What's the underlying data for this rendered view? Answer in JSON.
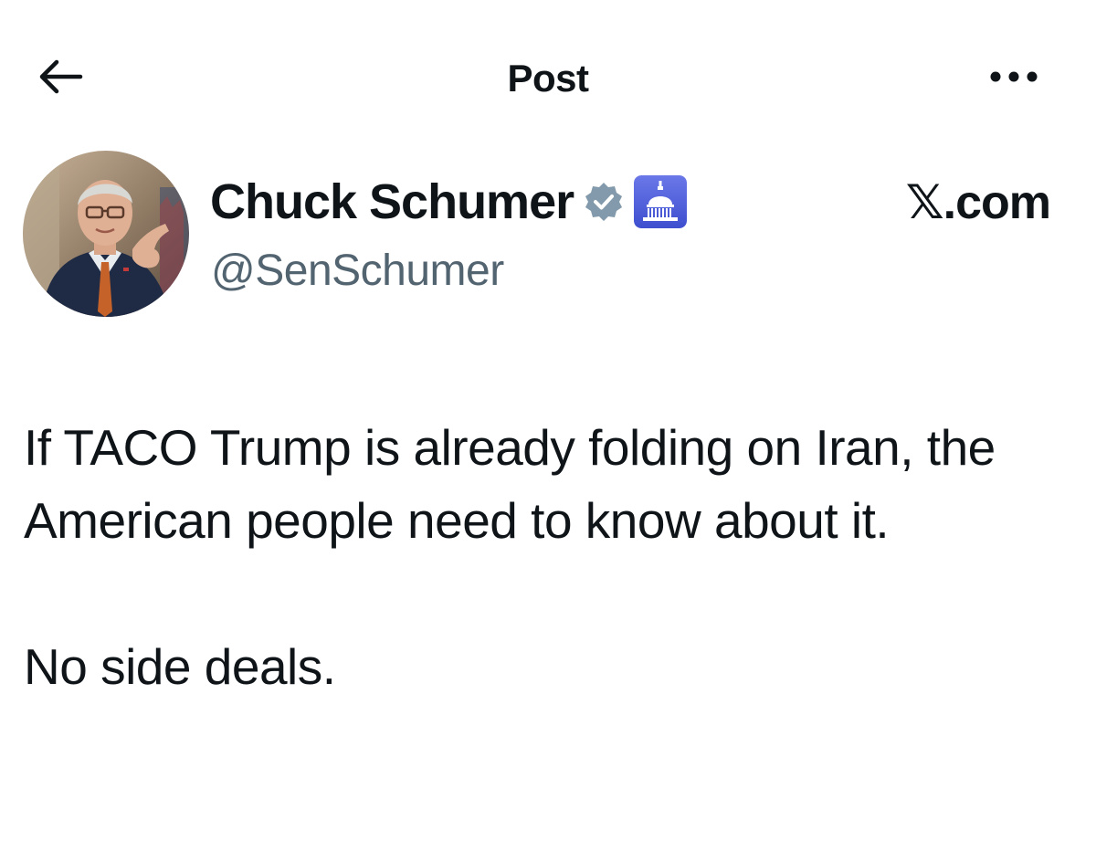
{
  "header": {
    "title": "Post",
    "back_icon": "arrow-left-icon",
    "more_icon": "more-horizontal-icon"
  },
  "author": {
    "display_name": "Chuck Schumer",
    "handle": "@SenSchumer",
    "verified_icon": "verified-badge-icon",
    "affiliate_icon": "capitol-dome-icon",
    "verified_color": "#829aab",
    "affiliate_color": "#4f5fd9"
  },
  "source": {
    "label": "𝕏.com"
  },
  "post": {
    "paragraphs": [
      "If TACO Trump is already folding on Iran, the American people need to know about it.",
      "No side deals."
    ]
  },
  "colors": {
    "text_primary": "#0f1419",
    "text_secondary": "#536471",
    "background": "#ffffff"
  }
}
